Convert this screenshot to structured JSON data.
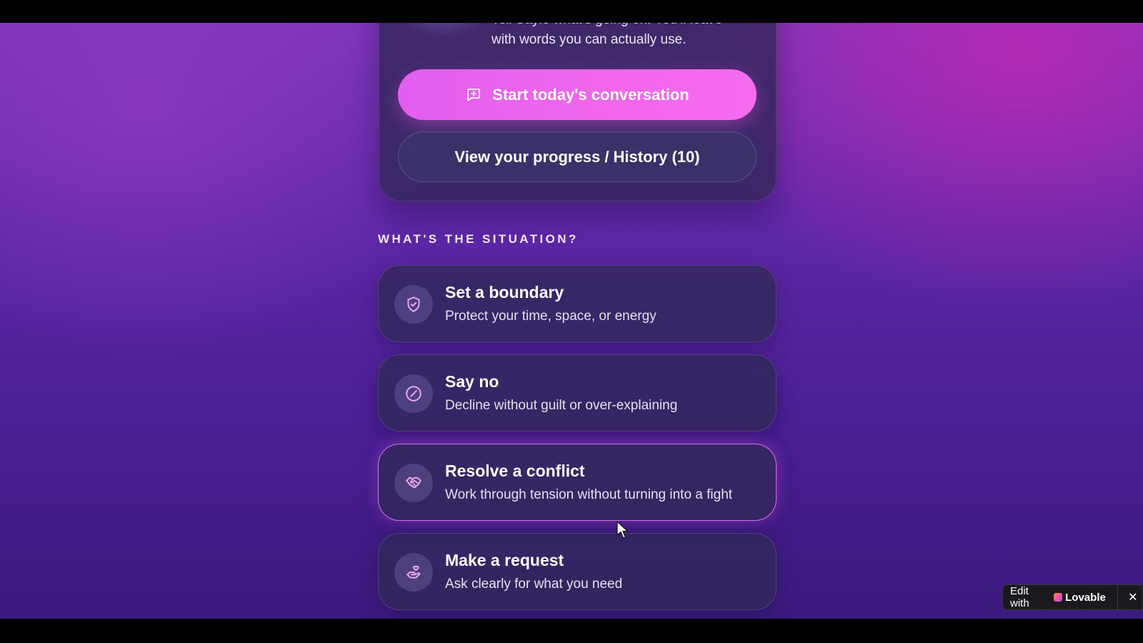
{
  "hero": {
    "description_line1": "Tell Sayle what's going on. You'll leave",
    "description_line2": "with words you can actually use."
  },
  "actions": {
    "primary_label": "Start today's conversation",
    "secondary_label": "View your progress / History (10)"
  },
  "situations": {
    "heading": "WHAT'S THE SITUATION?",
    "items": [
      {
        "title": "Set a boundary",
        "subtitle": "Protect your time, space, or energy",
        "icon": "shield-check-icon"
      },
      {
        "title": "Say no",
        "subtitle": "Decline without guilt or over-explaining",
        "icon": "prohibited-icon"
      },
      {
        "title": "Resolve a conflict",
        "subtitle": "Work through tension without turning into a fight",
        "icon": "handshake-icon"
      },
      {
        "title": "Make a request",
        "subtitle": "Ask clearly for what you need",
        "icon": "hand-heart-icon"
      }
    ]
  },
  "badge": {
    "prefix": "Edit with",
    "brand": "Lovable",
    "close": "✕"
  },
  "colors": {
    "accent": "#f067ea",
    "icon_stroke": "#f0a6f4",
    "active_border": "#da78f5"
  }
}
